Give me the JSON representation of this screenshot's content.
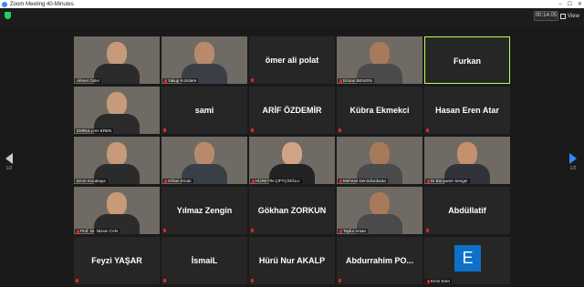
{
  "window": {
    "title": "Zoom Meeting 40-Minutes"
  },
  "toolbar": {
    "timer": "00:14:05",
    "view_label": "View"
  },
  "pagination": {
    "left": "1/2",
    "right": "1/2"
  },
  "tiles": [
    {
      "name": "Ahmet Güler",
      "kind": "camera",
      "muted": false
    },
    {
      "name": "Yakup Kızıldere",
      "kind": "camera",
      "muted": true
    },
    {
      "name": "ömer ali polat",
      "kind": "name",
      "muted": true
    },
    {
      "name": "Erman BENGİN",
      "kind": "camera",
      "muted": true
    },
    {
      "name": "Furkan",
      "kind": "name",
      "muted": false,
      "active": true
    },
    {
      "name": "EMRULLAH EREN",
      "kind": "camera",
      "muted": false
    },
    {
      "name": "sami",
      "kind": "name",
      "muted": true
    },
    {
      "name": "ARİF ÖZDEMİR",
      "kind": "name",
      "muted": true
    },
    {
      "name": "Kübra Ekmekci",
      "kind": "name",
      "muted": true
    },
    {
      "name": "Hasan Eren Atar",
      "kind": "name",
      "muted": true
    },
    {
      "name": "Emre Kocakaya",
      "kind": "camera",
      "muted": false
    },
    {
      "name": "Orhan Ercan",
      "kind": "camera",
      "muted": true
    },
    {
      "name": "HÜSEYİN ÇİFTÇİOĞLU",
      "kind": "camera",
      "muted": true
    },
    {
      "name": "Mehmet Denizdurduran",
      "kind": "camera",
      "muted": true
    },
    {
      "name": "Dr.Bünyamin kenger",
      "kind": "camera",
      "muted": true
    },
    {
      "name": "Prof. Dr. Nizam CAN",
      "kind": "camera",
      "muted": true
    },
    {
      "name": "Yılmaz Zengin",
      "kind": "name",
      "muted": true
    },
    {
      "name": "Gökhan ZORKUN",
      "kind": "name",
      "muted": true
    },
    {
      "name": "Tayfur Aman",
      "kind": "camera",
      "muted": true
    },
    {
      "name": "Abdüllatif",
      "kind": "name",
      "muted": true
    },
    {
      "name": "Feyzi YAŞAR",
      "kind": "name",
      "muted": true
    },
    {
      "name": "İsmaiL",
      "kind": "name",
      "muted": true
    },
    {
      "name": "Hürü Nur AKALP",
      "kind": "name",
      "muted": true
    },
    {
      "name": "Abdurrahim  PO...",
      "kind": "name",
      "muted": true
    },
    {
      "name": "Emin Eren",
      "kind": "avatar",
      "avatar_letter": "E",
      "muted": true
    }
  ]
}
